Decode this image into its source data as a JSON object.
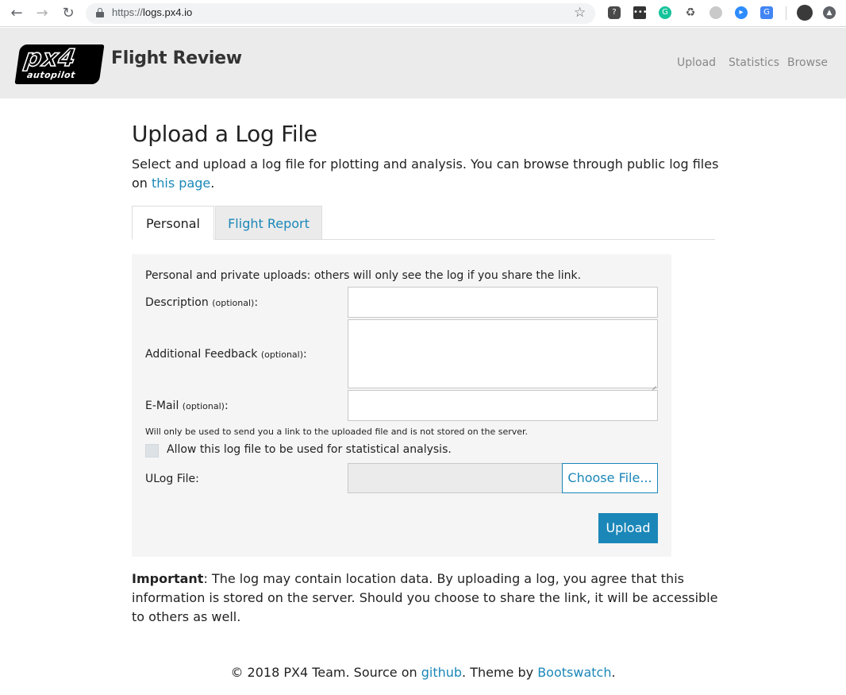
{
  "browser": {
    "url_scheme": "https://",
    "url_host": "logs.px4.io",
    "back_glyph": "←",
    "forward_glyph": "→",
    "reload_glyph": "↻",
    "star_glyph": "☆"
  },
  "navbar": {
    "logo_main": "px4",
    "logo_sub": "autopilot",
    "brand": "Flight Review",
    "links": [
      "Upload",
      "Statistics",
      "Browse"
    ]
  },
  "main": {
    "title": "Upload a Log File",
    "intro_text": "Select and upload a log file for plotting and analysis. You can browse through public log files on ",
    "intro_link": "this page",
    "intro_end": ".",
    "tabs": [
      {
        "label": "Personal",
        "active": true
      },
      {
        "label": "Flight Report",
        "active": false
      }
    ]
  },
  "form": {
    "note": "Personal and private uploads: others will only see the log if you share the link.",
    "description_label": "Description ",
    "description_optional": "(optional)",
    "description_colon": ":",
    "feedback_label": "Additional Feedback ",
    "feedback_optional": "(optional)",
    "feedback_colon": ":",
    "email_label": "E-Mail ",
    "email_optional": "(optional)",
    "email_colon": ":",
    "email_help": "Will only be used to send you a link to the uploaded file and is not stored on the server.",
    "checkbox_label": "Allow this log file to be used for statistical analysis.",
    "checkbox_checked": false,
    "ulog_label": "ULog File:",
    "choose_file_label": "Choose File...",
    "upload_label": "Upload"
  },
  "notice": {
    "bold": "Important",
    "text": ": The log may contain location data. By uploading a log, you agree that this information is stored on the server. Should you choose to share the link, it will be accessible to others as well."
  },
  "footer": {
    "prefix": "© 2018 PX4 Team. Source on ",
    "github_link": "github",
    "middle": ". Theme by ",
    "theme_link": "Bootswatch",
    "end": "."
  },
  "colors": {
    "accent": "#1b87b8",
    "navbar_bg": "#ebebeb",
    "panel_bg": "#f5f5f5"
  }
}
